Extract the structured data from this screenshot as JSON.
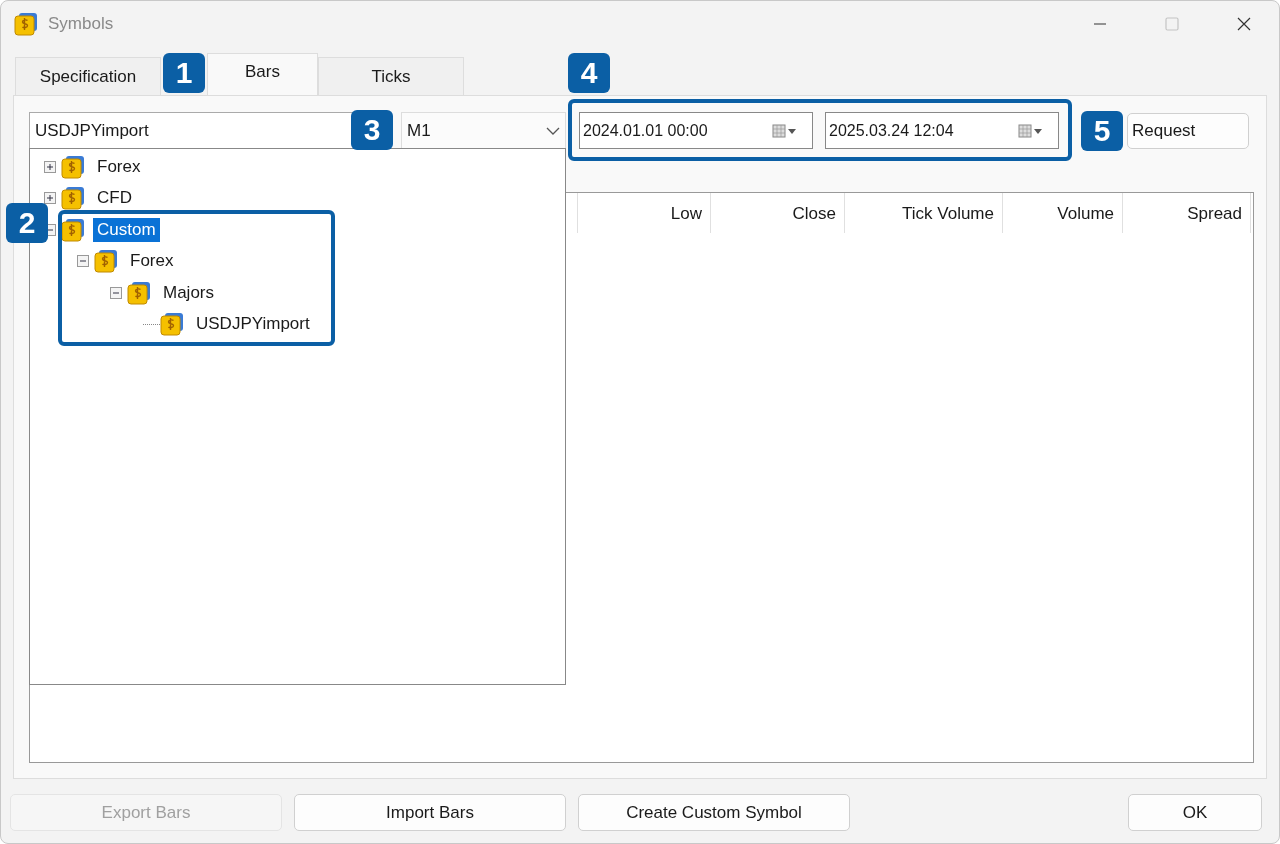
{
  "window": {
    "title": "Symbols"
  },
  "tabs": [
    {
      "label": "Specification",
      "selected": false
    },
    {
      "label": "Bars",
      "selected": true
    },
    {
      "label": "Ticks",
      "selected": false
    }
  ],
  "symbol_field": {
    "value": "USDJPYimport"
  },
  "timeframe": {
    "value": "M1"
  },
  "date_from": {
    "value": "2024.01.01 00:00"
  },
  "date_to": {
    "value": "2025.03.24 12:04"
  },
  "request_button": "Request",
  "tree": [
    {
      "label": "Forex",
      "expanded": false,
      "selected": false
    },
    {
      "label": "CFD",
      "expanded": false,
      "selected": false
    },
    {
      "label": "Custom",
      "expanded": true,
      "selected": true,
      "children": [
        {
          "label": "Forex",
          "expanded": true,
          "selected": false,
          "children": [
            {
              "label": "Majors",
              "expanded": true,
              "selected": false,
              "children": [
                {
                  "label": "USDJPYimport",
                  "selected": false
                }
              ]
            }
          ]
        }
      ]
    }
  ],
  "table": {
    "columns": [
      "Low",
      "Close",
      "Tick Volume",
      "Volume",
      "Spread"
    ]
  },
  "buttons": [
    {
      "label": "Export Bars",
      "disabled": true
    },
    {
      "label": "Import Bars",
      "disabled": false
    },
    {
      "label": "Create Custom Symbol",
      "disabled": false
    },
    {
      "label": "OK",
      "disabled": false
    }
  ],
  "callouts": [
    {
      "label": "1",
      "framed": false
    },
    {
      "label": "2",
      "framed": true
    },
    {
      "label": "3",
      "framed": false
    },
    {
      "label": "4",
      "framed": true
    },
    {
      "label": "5",
      "framed": false
    }
  ]
}
